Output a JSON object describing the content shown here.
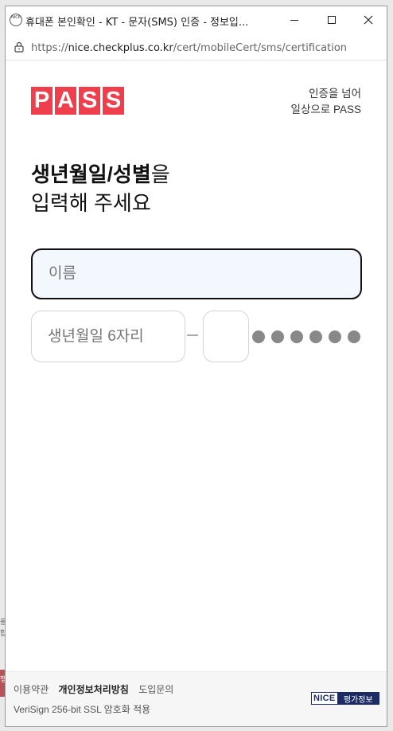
{
  "window": {
    "title": "휴대폰 본인확인 - KT - 문자(SMS) 인증 - 정보입...",
    "app_icon_text": "NICE",
    "url_scheme": "https://",
    "url_host": "nice.checkplus.co.kr",
    "url_path": "/cert/mobileCert/sms/certification"
  },
  "brand": {
    "logo_letters": [
      "P",
      "A",
      "S",
      "S"
    ],
    "logo_color": "#ef3f4c",
    "tagline_line1": "인증을 넘어",
    "tagline_line2": "일상으로 PASS"
  },
  "headline": {
    "bold": "생년월일/성별",
    "normal": "을",
    "line2": "입력해 주세요"
  },
  "form": {
    "name_placeholder": "이름",
    "birth_placeholder": "생년월일 6자리",
    "gender_value": "",
    "masked_digit_count": 6
  },
  "footer": {
    "terms": "이용약관",
    "privacy": "개인정보처리방침",
    "inquiry": "도입문의",
    "ssl": "VeriSign 256-bit SSL 암호화 적용",
    "nice_brand": "NICE",
    "nice_sub": "평가정보"
  },
  "background_partial": {
    "chars": [
      "를",
      "합",
      "행"
    ]
  }
}
